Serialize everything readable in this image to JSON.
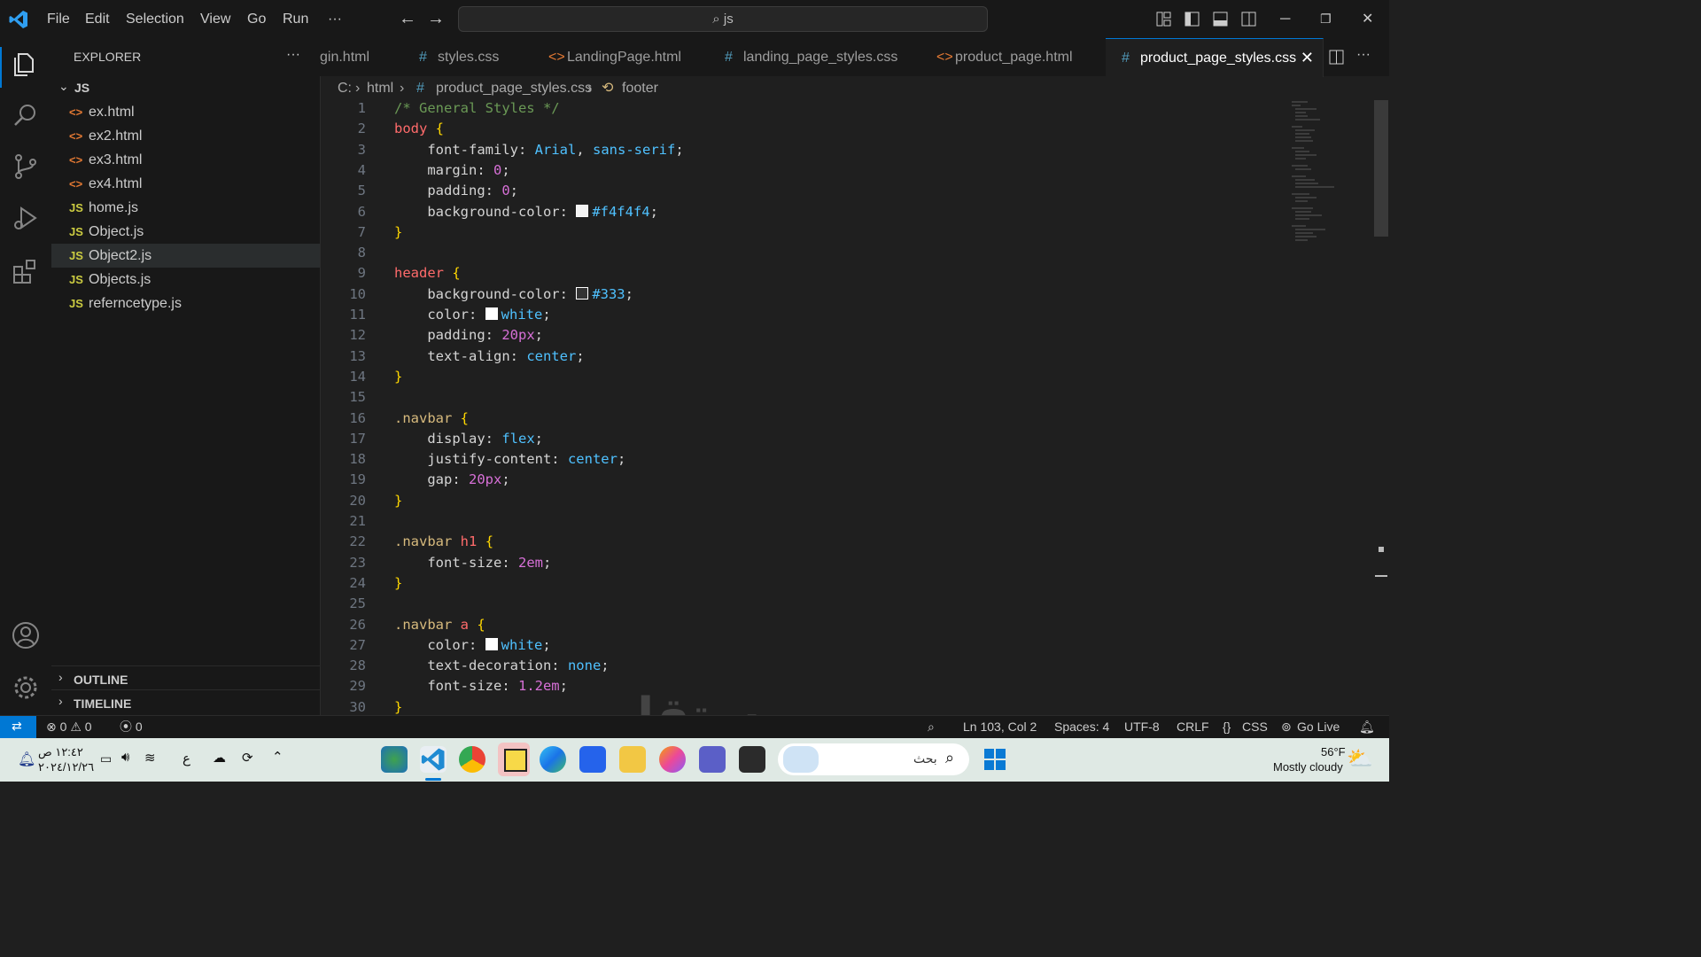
{
  "menu": [
    "File",
    "Edit",
    "Selection",
    "View",
    "Go",
    "Run",
    "···"
  ],
  "search": {
    "text": "js"
  },
  "explorer": {
    "title": "EXPLORER",
    "folder": "JS",
    "files": [
      {
        "icon": "<>",
        "name": "ex.html",
        "type": "html"
      },
      {
        "icon": "<>",
        "name": "ex2.html",
        "type": "html"
      },
      {
        "icon": "<>",
        "name": "ex3.html",
        "type": "html"
      },
      {
        "icon": "<>",
        "name": "ex4.html",
        "type": "html"
      },
      {
        "icon": "JS",
        "name": "home.js",
        "type": "js"
      },
      {
        "icon": "JS",
        "name": "Object.js",
        "type": "js"
      },
      {
        "icon": "JS",
        "name": "Object2.js",
        "type": "js",
        "selected": true
      },
      {
        "icon": "JS",
        "name": "Objects.js",
        "type": "js"
      },
      {
        "icon": "JS",
        "name": "referncetype.js",
        "type": "js"
      }
    ],
    "outline": "OUTLINE",
    "timeline": "TIMELINE"
  },
  "tabs": [
    {
      "icon": "",
      "label": "gin.html"
    },
    {
      "icon": "#",
      "label": "styles.css"
    },
    {
      "icon": "<>",
      "label": "LandingPage.html"
    },
    {
      "icon": "#",
      "label": "landing_page_styles.css"
    },
    {
      "icon": "<>",
      "label": "product_page.html"
    },
    {
      "icon": "#",
      "label": "product_page_styles.css",
      "active": true
    }
  ],
  "breadcrumb": {
    "drive": "C:",
    "folder": "html",
    "file": "product_page_styles.css",
    "symbol": "footer"
  },
  "code_lines": [
    "/* General Styles */",
    "body {",
    "    font-family: Arial, sans-serif;",
    "    margin: 0;",
    "    padding: 0;",
    "    background-color: #f4f4f4;",
    "}",
    "",
    "header {",
    "    background-color: #333;",
    "    color: white;",
    "    padding: 20px;",
    "    text-align: center;",
    "}",
    "",
    ".navbar {",
    "    display: flex;",
    "    justify-content: center;",
    "    gap: 20px;",
    "}",
    "",
    ".navbar h1 {",
    "    font-size: 2em;",
    "}",
    "",
    ".navbar a {",
    "    color: white;",
    "    text-decoration: none;",
    "    font-size: 1.2em;",
    "}"
  ],
  "status": {
    "errors": "0",
    "warnings": "0",
    "ports": "0",
    "position": "Ln 103, Col 2",
    "spaces": "Spaces: 4",
    "encoding": "UTF-8",
    "eol": "CRLF",
    "language": "CSS",
    "golive": "Go Live"
  },
  "taskbar": {
    "time": "١٢:٤٢ ص",
    "date": "٢٠٢٤/١٢/٢٦",
    "lang": "ع",
    "search_placeholder": "بحث",
    "weather_temp": "56°F",
    "weather_text": "Mostly cloudy"
  },
  "watermark": "مستقل",
  "colors": {
    "accent": "#0078d4",
    "selector": "#d7ba7d",
    "value": "#4fc1ff",
    "number": "#d770d7",
    "comment": "#6a9955",
    "jsicon": "#cbcb41",
    "htmlicon": "#e37933"
  }
}
